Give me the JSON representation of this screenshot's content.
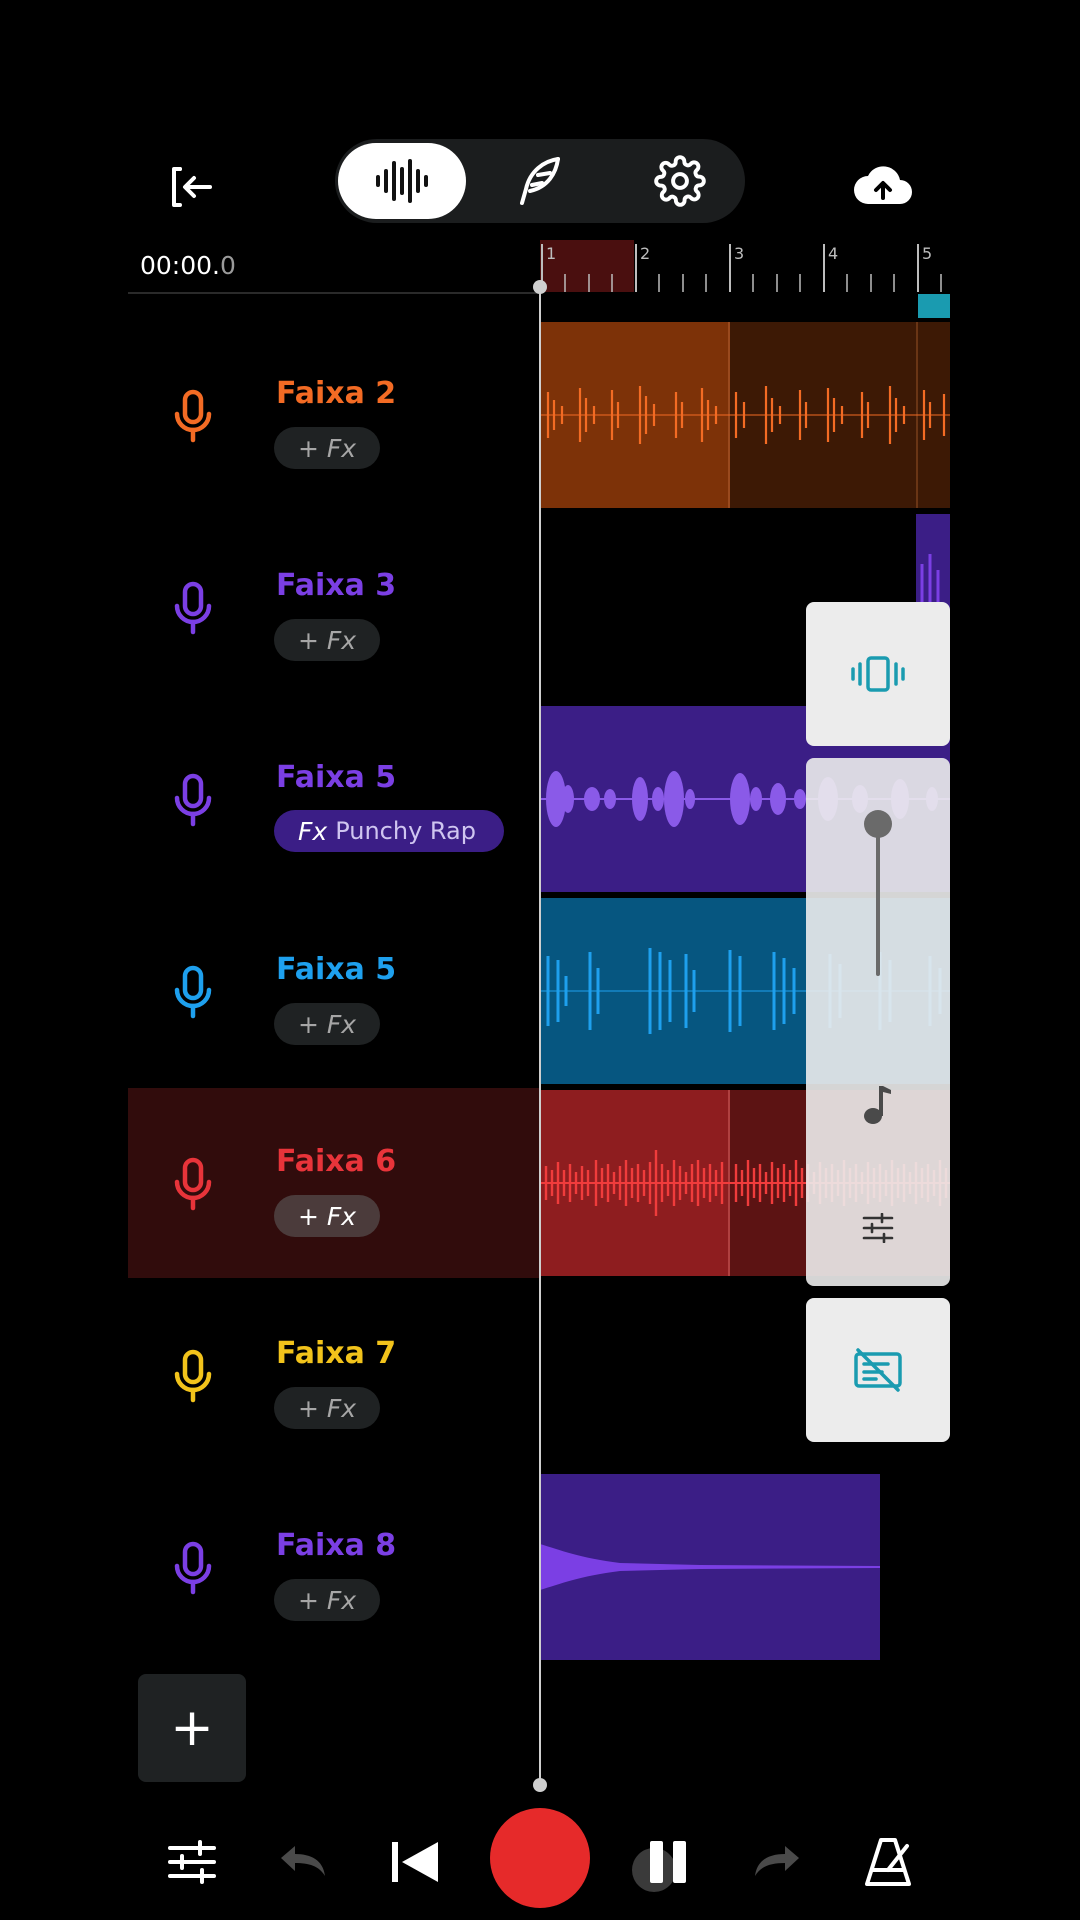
{
  "header": {
    "exit_icon": "exit-icon",
    "tabs": [
      {
        "name": "waveform-tab",
        "icon": "waveform-icon",
        "active": true
      },
      {
        "name": "feather-tab",
        "icon": "feather-icon",
        "active": false
      },
      {
        "name": "settings-tab",
        "icon": "gear-icon",
        "active": false
      }
    ],
    "upload_icon": "cloud-upload-icon"
  },
  "timeline": {
    "time_main": "00:00.",
    "time_frac": "0",
    "bars": [
      "1",
      "2",
      "3",
      "4",
      "5"
    ]
  },
  "tracks": [
    {
      "name": "Faixa 2",
      "color": "#f36b24",
      "fx_label": "+ Fx"
    },
    {
      "name": "Faixa 3",
      "color": "#7b3fe4",
      "fx_label": "+ Fx"
    },
    {
      "name": "Faixa 5",
      "color": "#7b3fe4",
      "fx_label": "Fx",
      "fx_preset": "Punchy Rap"
    },
    {
      "name": "Faixa 5",
      "color": "#1ea0ee",
      "fx_label": "+ Fx"
    },
    {
      "name": "Faixa 6",
      "color": "#e8343a",
      "fx_label": "+ Fx",
      "selected": true
    },
    {
      "name": "Faixa 7",
      "color": "#f2c31b",
      "fx_label": "+ Fx"
    },
    {
      "name": "Faixa 8",
      "color": "#7b3fe4",
      "fx_label": "+ Fx"
    }
  ],
  "add_track_label": "+",
  "side_panel": {
    "vibrate_icon": "vibrate-icon",
    "volume_level": 0.0,
    "note_icon": "music-note-icon",
    "mixer_icon": "tune-icon",
    "lyrics_icon": "lyrics-off-icon"
  },
  "transport": {
    "mixer": "sliders-icon",
    "undo": "undo-icon",
    "skip_back": "skip-back-icon",
    "record": "record-button",
    "pause": "pause-icon",
    "redo": "redo-icon",
    "metronome": "metronome-icon"
  },
  "colors": {
    "orange": "#f36b24",
    "purple": "#7b3fe4",
    "blue": "#1ea0ee",
    "red": "#e8343a",
    "yellow": "#f2c31b",
    "record": "#e62a2a",
    "accent": "#1a9bb0"
  }
}
